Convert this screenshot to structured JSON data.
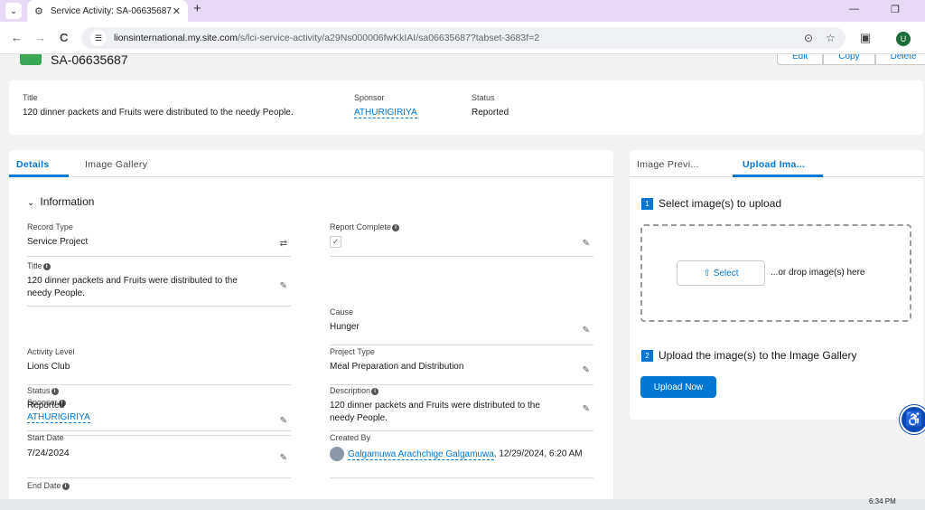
{
  "browser": {
    "tab_title": "Service Activity: SA-06635687",
    "url_host": "lionsinternational.my.site.com",
    "url_path": "/s/lci-service-activity/a29Ns000006fwKkIAI/sa06635687?tabset-3683f=2",
    "profile_initial": "U",
    "new_tab": "+",
    "menu_glyph": "⌄",
    "close_glyph": "✕",
    "back": "←",
    "forward": "→",
    "reload": "C",
    "minimize": "—",
    "restore": "❐",
    "location_glyph": "⊙",
    "star_glyph": "☆",
    "extensions_glyph": "▣"
  },
  "record": {
    "number": "SA-06635687",
    "actions": [
      "Edit",
      "Copy",
      "Delete"
    ]
  },
  "highlights": {
    "title_label": "Title",
    "title_value": "120 dinner packets and Fruits were distributed to the needy People.",
    "sponsor_label": "Sponsor",
    "sponsor_value": "ATHURIGIRIYA",
    "status_label": "Status",
    "status_value": "Reported"
  },
  "left_tabs": [
    "Details",
    "Image Gallery"
  ],
  "section_title": "Information",
  "fields": {
    "record_type": {
      "label": "Record Type",
      "value": "Service Project"
    },
    "report_complete": {
      "label": "Report Complete",
      "checked": true
    },
    "title": {
      "label": "Title",
      "value": "120 dinner packets and Fruits were distributed to the needy People."
    },
    "sponsor": {
      "label": "Sponsor",
      "value": "ATHURIGIRIYA"
    },
    "cause": {
      "label": "Cause",
      "value": "Hunger"
    },
    "activity_level": {
      "label": "Activity Level",
      "value": "Lions Club"
    },
    "project_type": {
      "label": "Project Type",
      "value": "Meal Preparation and Distribution"
    },
    "status": {
      "label": "Status",
      "value": "Reported"
    },
    "description": {
      "label": "Description",
      "value": "120 dinner packets and Fruits were distributed to the needy People."
    },
    "start_date": {
      "label": "Start Date",
      "value": "7/24/2024"
    },
    "created_by": {
      "label": "Created By",
      "user": "Galgamuwa Arachchige Galgamuwa",
      "date": ", 12/29/2024, 6:20 AM"
    },
    "end_date": {
      "label": "End Date"
    }
  },
  "right_tabs": [
    "Image Previ...",
    "Upload Ima..."
  ],
  "upload": {
    "step1_num": "1",
    "step1_text": "Select image(s) to upload",
    "select_label": "Select",
    "drop_text": "...or drop image(s) here",
    "step2_num": "2",
    "step2_text": "Upload the image(s) to the Image Gallery",
    "upload_now_label": "Upload Now"
  },
  "taskbar": {
    "time": "6:34 PM"
  }
}
